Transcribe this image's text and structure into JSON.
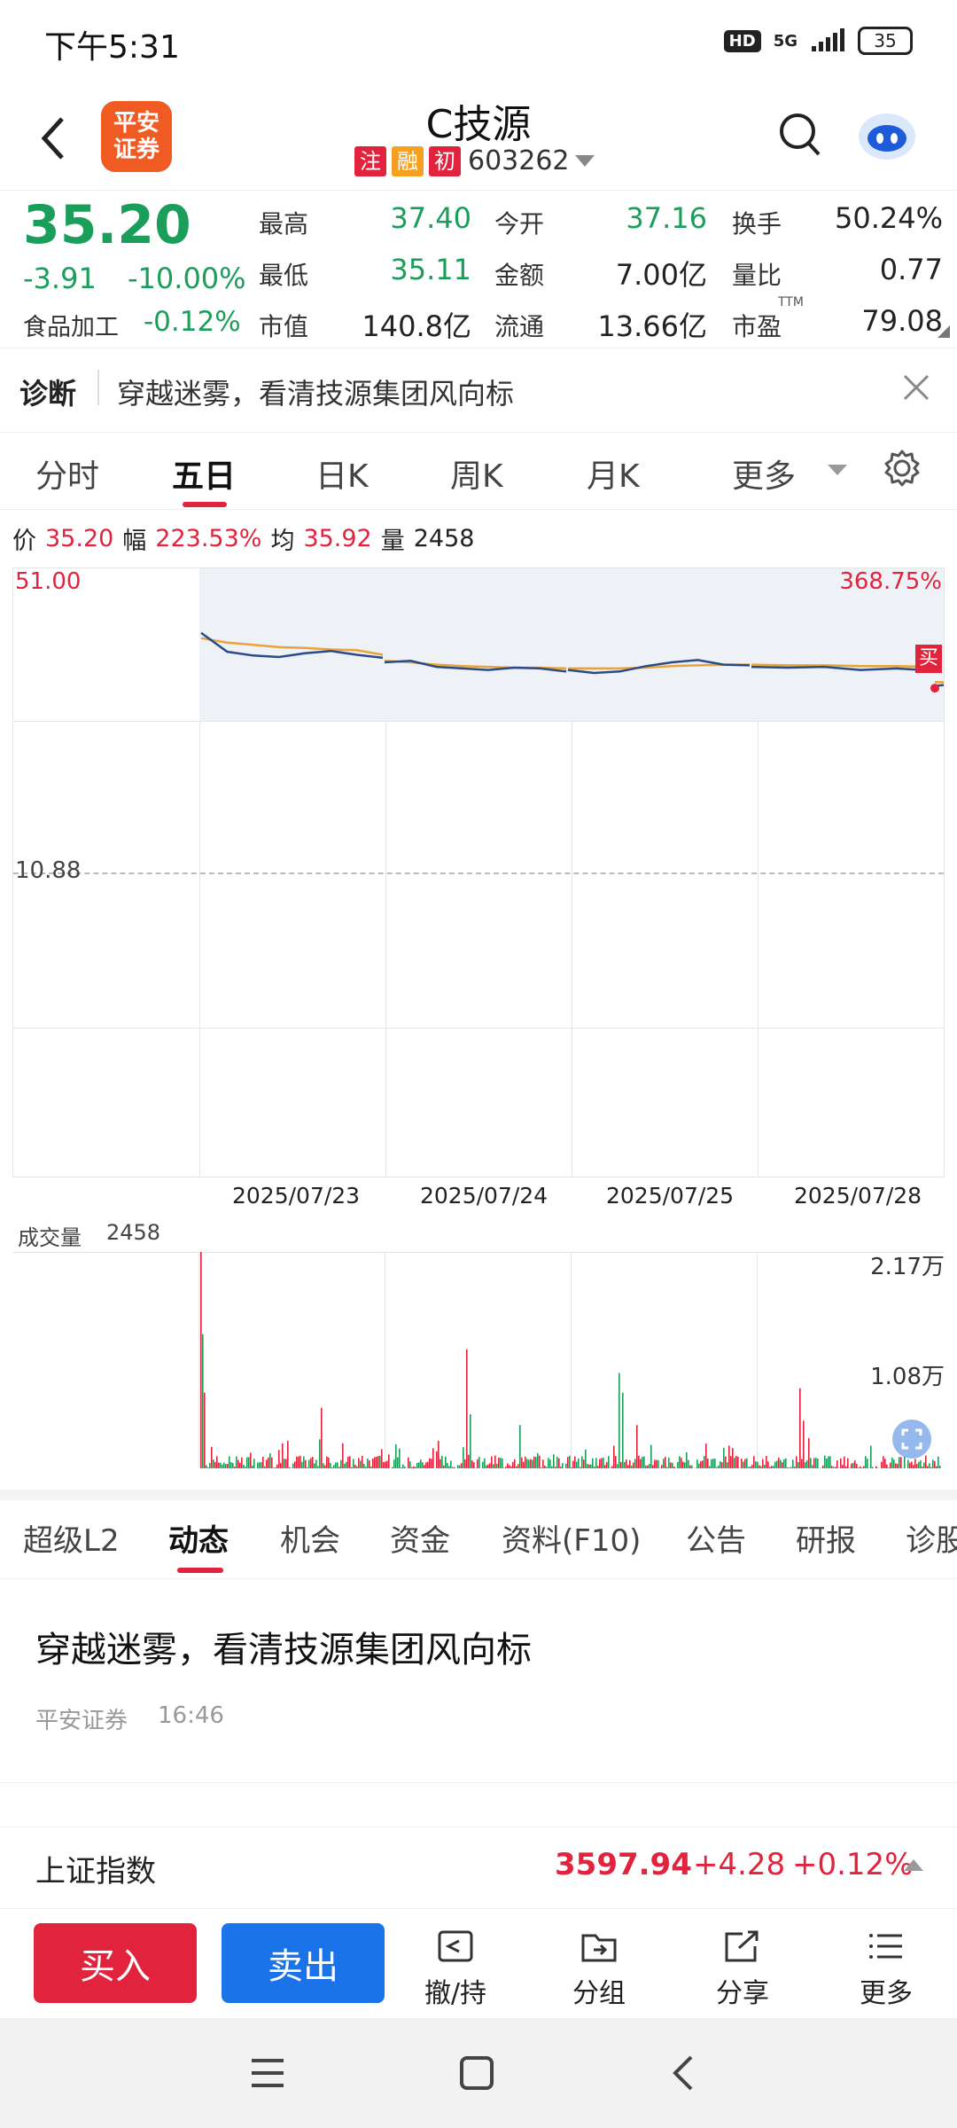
{
  "status": {
    "time": "下午5:31",
    "network": "5G",
    "battery": "35",
    "hd": "HD"
  },
  "header": {
    "title": "C技源",
    "code": "603262",
    "logo_line1": "平安",
    "logo_line2": "证券",
    "tags": [
      "注",
      "融",
      "初"
    ]
  },
  "quote": {
    "price": "35.20",
    "change": "-3.91",
    "change_pct": "-10.00%",
    "sector": "食品加工",
    "sector_pct": "-0.12%",
    "high_label": "最高",
    "high": "37.40",
    "low_label": "最低",
    "low": "35.11",
    "mcap_label": "市值",
    "mcap": "140.8亿",
    "open_label": "今开",
    "open": "37.16",
    "amount_label": "金额",
    "amount": "7.00亿",
    "float_label": "流通",
    "float": "13.66亿",
    "turnover_label": "换手",
    "turnover": "50.24%",
    "vr_label": "量比",
    "vr": "0.77",
    "pe_label": "市盈",
    "pe_sup": "TTM",
    "pe": "79.08"
  },
  "diagnosis": {
    "label": "诊断",
    "text": "穿越迷雾，看清技源集团风向标"
  },
  "chart_tabs": {
    "items": [
      "分时",
      "五日",
      "日K",
      "周K",
      "月K",
      "更多"
    ],
    "active": "五日"
  },
  "chart_info": {
    "price_label": "价",
    "price": "35.20",
    "range_label": "幅",
    "range": "223.53%",
    "avg_label": "均",
    "avg": "35.92",
    "vol_label": "量",
    "vol": "2458"
  },
  "chart_data": {
    "type": "line",
    "title": "",
    "x_labels": [
      "2025/07/23",
      "2025/07/24",
      "2025/07/25",
      "2025/07/28"
    ],
    "y_top": "51.00",
    "y_mid": "10.88",
    "y_top_pct": "368.75%",
    "price_series": [
      42.5,
      40.0,
      39.5,
      39.3,
      39.8,
      40.1,
      39.6,
      39.2,
      38.6,
      38.8,
      38.0,
      37.8,
      37.6,
      37.9,
      37.8,
      37.4,
      37.6,
      37.2,
      37.4,
      38.1,
      38.6,
      38.9,
      38.3,
      38.2,
      38.0,
      37.9,
      38.0,
      37.6,
      37.8,
      37.5,
      35.5,
      35.8,
      35.6,
      35.4,
      35.6,
      35.3,
      35.5,
      35.2
    ],
    "avg_series": [
      41.8,
      41.2,
      40.9,
      40.6,
      40.5,
      40.3,
      40.2,
      39.6,
      38.8,
      38.6,
      38.3,
      38.1,
      38.0,
      37.9,
      37.9,
      37.8,
      37.8,
      37.8,
      37.8,
      37.9,
      38.1,
      38.2,
      38.3,
      38.3,
      38.3,
      38.2,
      38.2,
      38.1,
      38.1,
      38.0,
      36.0,
      35.9,
      35.9,
      35.9,
      35.9,
      35.8,
      35.8,
      35.9
    ],
    "buy_marker": "买",
    "volume_label": "成交量",
    "volume_value": "2458",
    "volume_max": "2.17万",
    "volume_mid": "1.08万"
  },
  "bottom_tabs": {
    "items": [
      "超级L2",
      "动态",
      "机会",
      "资金",
      "资料(F10)",
      "公告",
      "研报",
      "诊股"
    ],
    "active": "动态"
  },
  "news": {
    "title": "穿越迷雾，看清技源集团风向标",
    "source": "平安证券",
    "time": "16:46"
  },
  "index": {
    "name": "上证指数",
    "value": "3597.94",
    "change": "+4.28",
    "pct": "+0.12%"
  },
  "actions": {
    "buy": "买入",
    "sell": "卖出",
    "items": [
      "撤/持",
      "分组",
      "分享",
      "更多"
    ]
  },
  "colors": {
    "up": "#e2233d",
    "down": "#1b9e5a",
    "buy": "#e2233d",
    "sell": "#1a73e8",
    "accent": "#f05a23"
  }
}
